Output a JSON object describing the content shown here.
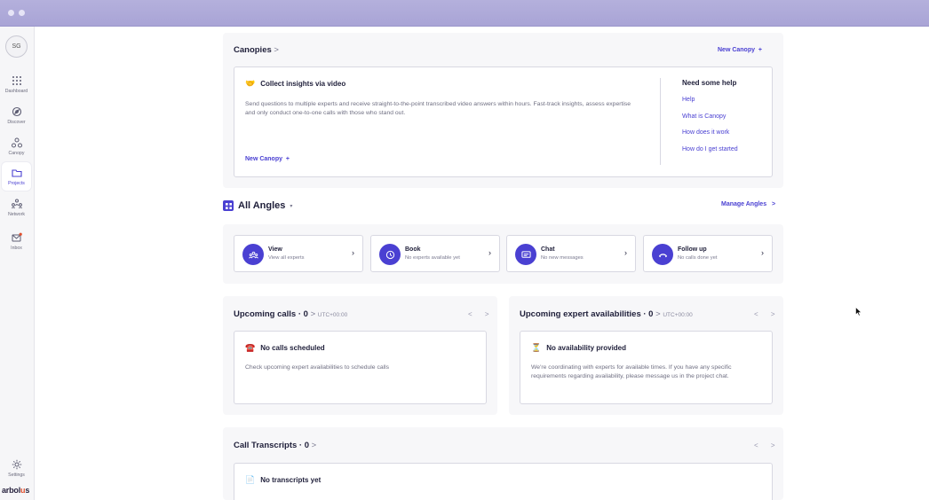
{
  "sidebar": {
    "avatar": "SG",
    "items": [
      {
        "label": "Dashboard",
        "icon": "grid-icon"
      },
      {
        "label": "Discover",
        "icon": "discover-icon"
      },
      {
        "label": "Canopy",
        "icon": "canopy-icon"
      },
      {
        "label": "Projects",
        "icon": "folder-icon"
      },
      {
        "label": "Network",
        "icon": "network-icon"
      },
      {
        "label": "Inbox",
        "icon": "mail-icon"
      },
      {
        "label": "Settings",
        "icon": "gear-icon"
      }
    ],
    "logo": {
      "before": "arbol",
      "accent": "u",
      "after": "s"
    }
  },
  "canopies": {
    "title": "Canopies",
    "chevron": ">",
    "new_label": "New Canopy",
    "plus": "+",
    "card": {
      "title": "Collect insights via video",
      "body": "Send questions to multiple experts and receive straight-to-the-point transcribed video answers within hours. Fast-track insights, assess expertise and only conduct one-to-one calls with those who stand out.",
      "new_label": "New Canopy",
      "plus": "+",
      "help_title": "Need some help",
      "help_links": [
        "Help",
        "What is Canopy",
        "How does it work",
        "How do I get started"
      ]
    }
  },
  "angles": {
    "title": "All Angles",
    "caret": "▾",
    "manage_label": "Manage Angles",
    "manage_chevron": ">"
  },
  "actions": [
    {
      "label": "View",
      "sub": "View all experts"
    },
    {
      "label": "Book",
      "sub": "No experts available yet"
    },
    {
      "label": "Chat",
      "sub": "No new messages"
    },
    {
      "label": "Follow up",
      "sub": "No calls done yet"
    }
  ],
  "upcoming_calls": {
    "title": "Upcoming calls · 0",
    "chevron": ">",
    "tz": "UTC+00:00",
    "arrows": "< >",
    "card_title": "No calls scheduled",
    "card_body": "Check upcoming expert availabilities to schedule calls"
  },
  "availabilities": {
    "title": "Upcoming expert availabilities · 0",
    "chevron": ">",
    "tz": "UTC+00:00",
    "arrows": "< >",
    "card_title": "No availability provided",
    "card_body": "We're coordinating with experts for available times. If you have any specific requirements regarding availability, please message us in the project chat."
  },
  "transcripts": {
    "title": "Call Transcripts · 0",
    "chevron": ">",
    "arrows": "< >",
    "card_title": "No transcripts yet"
  },
  "colors": {
    "accent": "#4a40d2",
    "titlebar": "#aaa5d7",
    "alert": "#e04f2d"
  }
}
